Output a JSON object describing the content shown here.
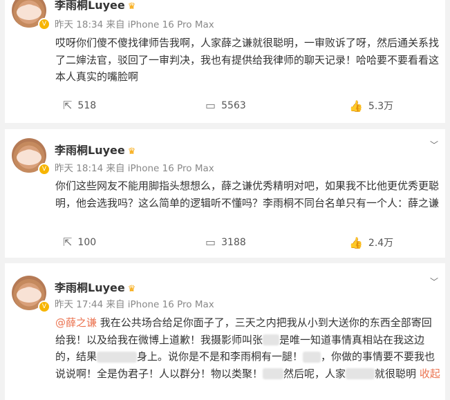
{
  "posts": [
    {
      "name": "李雨桐Luyee",
      "meta": "昨天 18:34 来自 iPhone 16 Pro Max",
      "text": "哎呀你们傻不傻找律师告我啊，人家薛之谦就很聪明，一审败诉了呀，然后通关系找了二婶法官，驳回了一审判决，我也有提供给我律师的聊天记录！哈哈要不要看看这本人真实的嘴脸啊",
      "reposts": "518",
      "comments": "5563",
      "likes": "5.3万"
    },
    {
      "name": "李雨桐Luyee",
      "meta": "昨天 18:14 来自 iPhone 16 Pro Max",
      "text": "你们这些网友不能用脚指头想想么，薛之谦优秀精明对吧，如果我不比他更优秀更聪明，他会选我吗？这么简单的逻辑听不懂吗？李雨桐不同台名单只有一个人：薛之谦",
      "reposts": "100",
      "comments": "3188",
      "likes": "2.4万"
    },
    {
      "name": "李雨桐Luyee",
      "meta": "昨天 17:44 来自 iPhone 16 Pro Max",
      "mention": "@薛之谦",
      "text_parts": [
        " 我在公共场合给足你面子了，三天之内把我从小到大送你的东西全部寄回给我！以及给我在微博上道歉！我摄影师叫张",
        "是唯一知道事情真相站在我这边的，结果",
        "身上。说你是不是和李雨桐有一腿！",
        "，你做的事情要不要我也说说啊！全是伪君子！人以群分！物以类聚！",
        "然后呢，人家",
        "就很聪明"
      ],
      "more": "收起"
    }
  ],
  "icons": {
    "repost": "repost-icon",
    "comment": "comment-icon",
    "like": "like-icon",
    "more": "chevron-down-icon",
    "verified": "verified-badge-icon",
    "crown": "crown-icon"
  },
  "colors": {
    "accent": "#eb7350",
    "badge": "#f7b500"
  }
}
